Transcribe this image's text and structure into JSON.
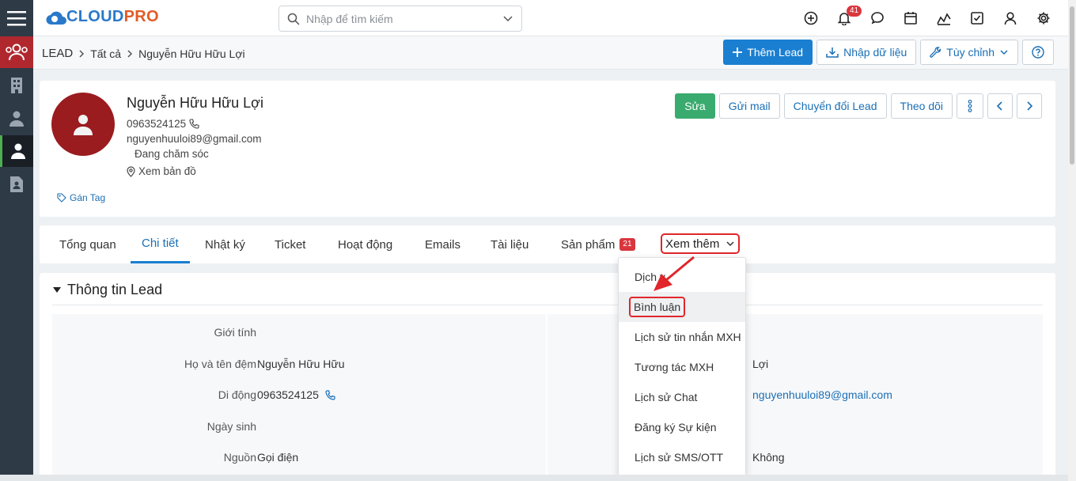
{
  "app": {
    "logo_main": "CLOUD",
    "logo_accent": "PRO",
    "logo_tagline": "..."
  },
  "search": {
    "placeholder": "Nhập để tìm kiếm"
  },
  "notifications": {
    "count": "41"
  },
  "breadcrumb": {
    "module": "LEAD",
    "filter": "Tất cả",
    "record": "Nguyễn Hữu Hữu Lợi"
  },
  "toolbar": {
    "add_lead": "Thêm Lead",
    "import": "Nhập dữ liệu",
    "customize": "Tùy chỉnh"
  },
  "profile": {
    "name": "Nguyễn Hữu Hữu Lợi",
    "phone": "0963524125",
    "email": "nguyenhuuloi89@gmail.com",
    "status": "Đang chăm sóc",
    "map": "Xem bản đồ",
    "tag": "Gán Tag",
    "actions": {
      "edit": "Sửa",
      "send_mail": "Gửi mail",
      "convert": "Chuyển đổi Lead",
      "follow": "Theo dõi"
    }
  },
  "tabs": [
    {
      "label": "Tổng quan"
    },
    {
      "label": "Chi tiết"
    },
    {
      "label": "Nhật ký"
    },
    {
      "label": "Ticket"
    },
    {
      "label": "Hoạt động"
    },
    {
      "label": "Emails"
    },
    {
      "label": "Tài liệu"
    },
    {
      "label": "Sản phẩm",
      "count": "21"
    }
  ],
  "more_tab": {
    "label": "Xem thêm"
  },
  "dropdown": {
    "items": [
      {
        "label": "Dịch v"
      },
      {
        "label": "Bình luận"
      },
      {
        "label": "Lịch sử tin nhắn MXH"
      },
      {
        "label": "Tương tác MXH"
      },
      {
        "label": "Lịch sử Chat"
      },
      {
        "label": "Đăng ký Sự kiện"
      },
      {
        "label": "Lịch sử SMS/OTT"
      }
    ]
  },
  "section": {
    "title": "Thông tin Lead",
    "left": [
      {
        "label": "Giới tính",
        "value": ""
      },
      {
        "label": "Họ và tên đệm",
        "value": "Nguyễn Hữu Hữu"
      },
      {
        "label": "Di động",
        "value": "0963524125"
      },
      {
        "label": "Ngày sinh",
        "value": ""
      },
      {
        "label": "Nguồn",
        "value": "Gọi điện"
      }
    ],
    "right": [
      {
        "value": ""
      },
      {
        "value": "Lợi"
      },
      {
        "value": "nguyenhuuloi89@gmail.com"
      },
      {
        "value": ""
      },
      {
        "value": "Không"
      }
    ]
  },
  "colors": {
    "primary": "#1a7fd1",
    "success": "#3aab6e",
    "danger": "#d9363e",
    "avatar": "#9a1c1f",
    "rail": "#2f3a47"
  }
}
